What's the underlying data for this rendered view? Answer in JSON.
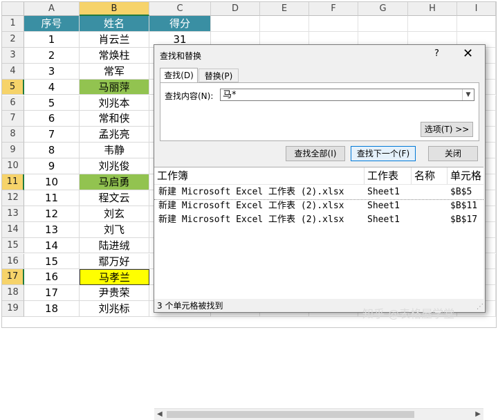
{
  "columns": [
    "A",
    "B",
    "C",
    "D",
    "E",
    "F",
    "G",
    "H",
    "I"
  ],
  "rows": [
    "1",
    "2",
    "3",
    "4",
    "5",
    "6",
    "7",
    "8",
    "9",
    "10",
    "11",
    "12",
    "13",
    "14",
    "15",
    "16",
    "17",
    "18",
    "19"
  ],
  "header": {
    "seq": "序号",
    "name": "姓名",
    "score": "得分"
  },
  "data": [
    {
      "seq": "1",
      "name": "肖云兰",
      "score": "31"
    },
    {
      "seq": "2",
      "name": "常焕柱",
      "score": ""
    },
    {
      "seq": "3",
      "name": "常军",
      "score": ""
    },
    {
      "seq": "4",
      "name": "马丽萍",
      "score": ""
    },
    {
      "seq": "5",
      "name": "刘兆本",
      "score": ""
    },
    {
      "seq": "6",
      "name": "常和侠",
      "score": ""
    },
    {
      "seq": "7",
      "name": "孟兆亮",
      "score": ""
    },
    {
      "seq": "8",
      "name": "韦静",
      "score": ""
    },
    {
      "seq": "9",
      "name": "刘兆俊",
      "score": ""
    },
    {
      "seq": "10",
      "name": "马启勇",
      "score": ""
    },
    {
      "seq": "11",
      "name": "程文云",
      "score": ""
    },
    {
      "seq": "12",
      "name": "刘玄",
      "score": ""
    },
    {
      "seq": "13",
      "name": "刘飞",
      "score": ""
    },
    {
      "seq": "14",
      "name": "陆进绒",
      "score": ""
    },
    {
      "seq": "15",
      "name": "鄢万好",
      "score": ""
    },
    {
      "seq": "16",
      "name": "马孝兰",
      "score": ""
    },
    {
      "seq": "17",
      "name": "尹贵荣",
      "score": ""
    },
    {
      "seq": "18",
      "name": "刘兆标",
      "score": ""
    }
  ],
  "colors": {
    "header_bg": "#3a8fa3",
    "green": "#92c350",
    "yellow": "#ffff00",
    "selected_hdr": "#f6d36a"
  },
  "dialog": {
    "title": "查找和替换",
    "help": "?",
    "close": "✕",
    "tab_find": "查找(D)",
    "tab_replace": "替换(P)",
    "find_label": "查找内容(N):",
    "find_value": "马*",
    "options_btn": "选项(T) >>",
    "find_all_btn": "查找全部(I)",
    "find_next_btn": "查找下一个(F)",
    "close_btn": "关闭",
    "results_headers": {
      "book": "工作簿",
      "sheet": "工作表",
      "name": "名称",
      "cell": "单元格"
    },
    "results": [
      {
        "book": "新建 Microsoft Excel 工作表 (2).xlsx",
        "sheet": "Sheet1",
        "cell": "$B$5"
      },
      {
        "book": "新建 Microsoft Excel 工作表 (2).xlsx",
        "sheet": "Sheet1",
        "cell": "$B$11"
      },
      {
        "book": "新建 Microsoft Excel 工作表 (2).xlsx",
        "sheet": "Sheet1",
        "cell": "$B$17"
      }
    ],
    "status": "3 个单元格被找到"
  },
  "watermark": "知乎 @表格屋学堂"
}
